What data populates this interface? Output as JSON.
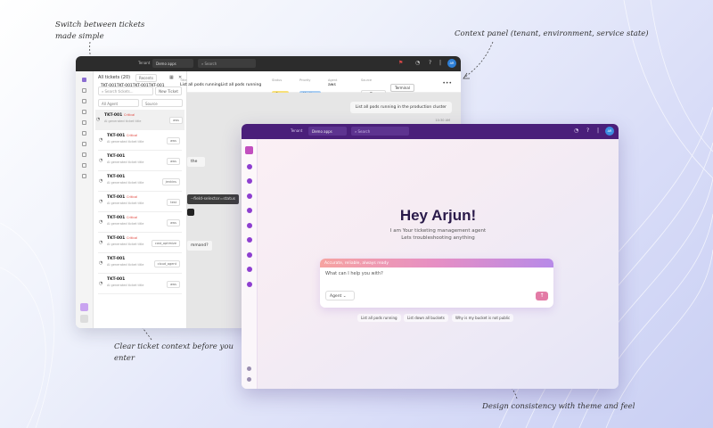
{
  "captions": {
    "switch_line1": "Switch between tickets",
    "switch_line2": "made simple",
    "context": "Context panel (tenant, environment, service state)",
    "clear_line1": "Clear ticket context before you",
    "clear_line2": "enter",
    "design": "Design consistency with theme and feel"
  },
  "back_window": {
    "topbar": {
      "tenant_label": "Tenant",
      "tenant_value": "Demo apps",
      "search_placeholder": "Search",
      "avatar": "AR"
    },
    "tickets_header": "All tickets (20)",
    "recents": "Recents",
    "search_placeholder": "Search tickets...",
    "new_ticket": "New Ticket",
    "filter_agent": "All Agent",
    "filter_source": "Source",
    "tickets": [
      {
        "id": "TKT-001",
        "critical": "Critical",
        "sub": "AI generated ticket title",
        "tag": "aws"
      },
      {
        "id": "TKT-001",
        "critical": "Critical",
        "sub": "AI generated ticket title",
        "tag": "aws"
      },
      {
        "id": "TKT-001",
        "critical": "",
        "sub": "AI generated ticket title",
        "tag": "aws"
      },
      {
        "id": "TKT-001",
        "critical": "",
        "sub": "AI generated ticket title",
        "tag": "jenkins"
      },
      {
        "id": "TKT-001",
        "critical": "Critical",
        "sub": "AI generated ticket title",
        "tag": "test"
      },
      {
        "id": "TKT-001",
        "critical": "Critical",
        "sub": "AI generated ticket title",
        "tag": "aws"
      },
      {
        "id": "TKT-001",
        "critical": "Critical",
        "sub": "AI generated ticket title",
        "tag": "cost_optimize"
      },
      {
        "id": "TKT-001",
        "critical": "",
        "sub": "AI generated ticket title",
        "tag": "cloud_agent"
      },
      {
        "id": "TKT-001",
        "critical": "",
        "sub": "AI generated ticket title",
        "tag": "aws"
      }
    ],
    "ticket_id_line": "TKT-001TKT-001TKT-001TKT-001",
    "context": {
      "title_key": "Title",
      "title_value": "List all pods runningList all pods running",
      "status_key": "Status",
      "status_value": "Open",
      "priority_key": "Priority",
      "priority_value": "Medium",
      "agent_key": "Agent",
      "agent_value": "aws",
      "source_key": "Source",
      "source_value": "Teams",
      "terminal": "Terminal"
    },
    "chat": {
      "message": "List all pods running in the production cluster",
      "time": "10:30 AM",
      "frag1": "the",
      "frag2": "--field-selector=status",
      "frag3": "mmand?"
    }
  },
  "front_window": {
    "topbar": {
      "tenant_label": "Tenant",
      "tenant_value": "Demo apps",
      "search_placeholder": "Search",
      "avatar": "AR"
    },
    "greeting": "Hey Arjun!",
    "subtitle_line1": "I am Your ticketing management agent",
    "subtitle_line2": "Lets troubleshooting anything",
    "composer": {
      "band": "Accurate, reliable, always ready",
      "placeholder": "What can I help you with?",
      "agent": "Agent",
      "send": "↑"
    },
    "suggestions": [
      "List all pods running",
      "List down all buckets",
      "Why is my bucket is not public"
    ]
  }
}
